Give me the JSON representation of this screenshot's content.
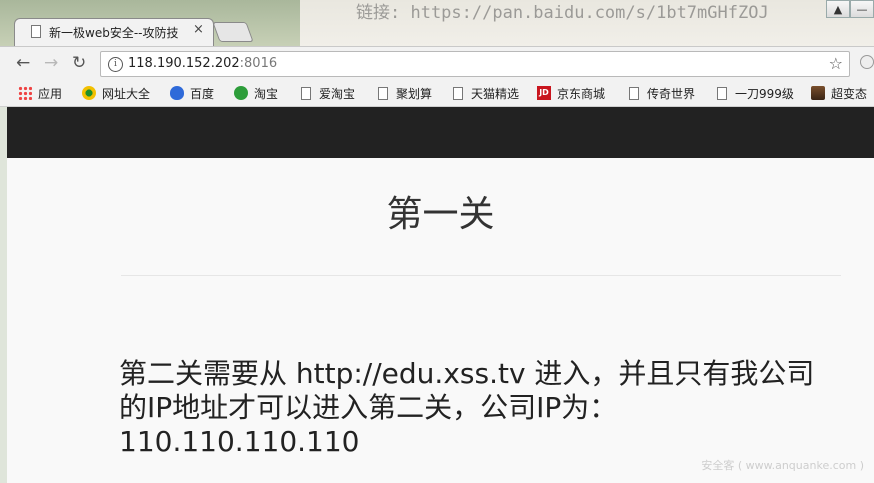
{
  "browser": {
    "background_text": "链接: https://pan.baidu.com/s/1bt7mGHfZOJ",
    "tab": {
      "title": "新一极web安全--攻防技",
      "close": "×"
    },
    "window_controls": [
      "▲",
      "—"
    ],
    "address": {
      "host": "118.190.152.202",
      "port": ":8016"
    },
    "icons": {
      "back": "back-arrow-icon",
      "forward": "forward-arrow-icon",
      "reload": "reload-icon",
      "info": "info-icon",
      "star": "star-icon"
    },
    "glyphs": {
      "back": "←",
      "forward": "→",
      "reload": "↻",
      "info": "i",
      "star": "☆"
    }
  },
  "bookmarks": [
    {
      "label": "应用",
      "icon": "apps-grid-icon"
    },
    {
      "label": "网址大全",
      "icon": "hao123-icon"
    },
    {
      "label": "百度",
      "icon": "baidu-paw-icon"
    },
    {
      "label": "淘宝",
      "icon": "taobao-icon"
    },
    {
      "label": "爱淘宝",
      "icon": "page-icon"
    },
    {
      "label": "聚划算",
      "icon": "page-icon"
    },
    {
      "label": "天猫精选",
      "icon": "page-icon"
    },
    {
      "label": "京东商城",
      "icon": "jd-icon"
    },
    {
      "label": "传奇世界",
      "icon": "page-icon"
    },
    {
      "label": "一刀999级",
      "icon": "page-icon"
    },
    {
      "label": "超变态",
      "icon": "avatar-icon"
    }
  ],
  "page": {
    "heading": "第一关",
    "message": "第二关需要从 http://edu.xss.tv 进入，并且只有我公司的IP地址才可以进入第二关，公司IP为：110.110.110.110",
    "watermark": "安全客 ( www.anquanke.com )"
  },
  "colors": {
    "navbar": "#222222",
    "page_bg": "#f9f9f9"
  }
}
